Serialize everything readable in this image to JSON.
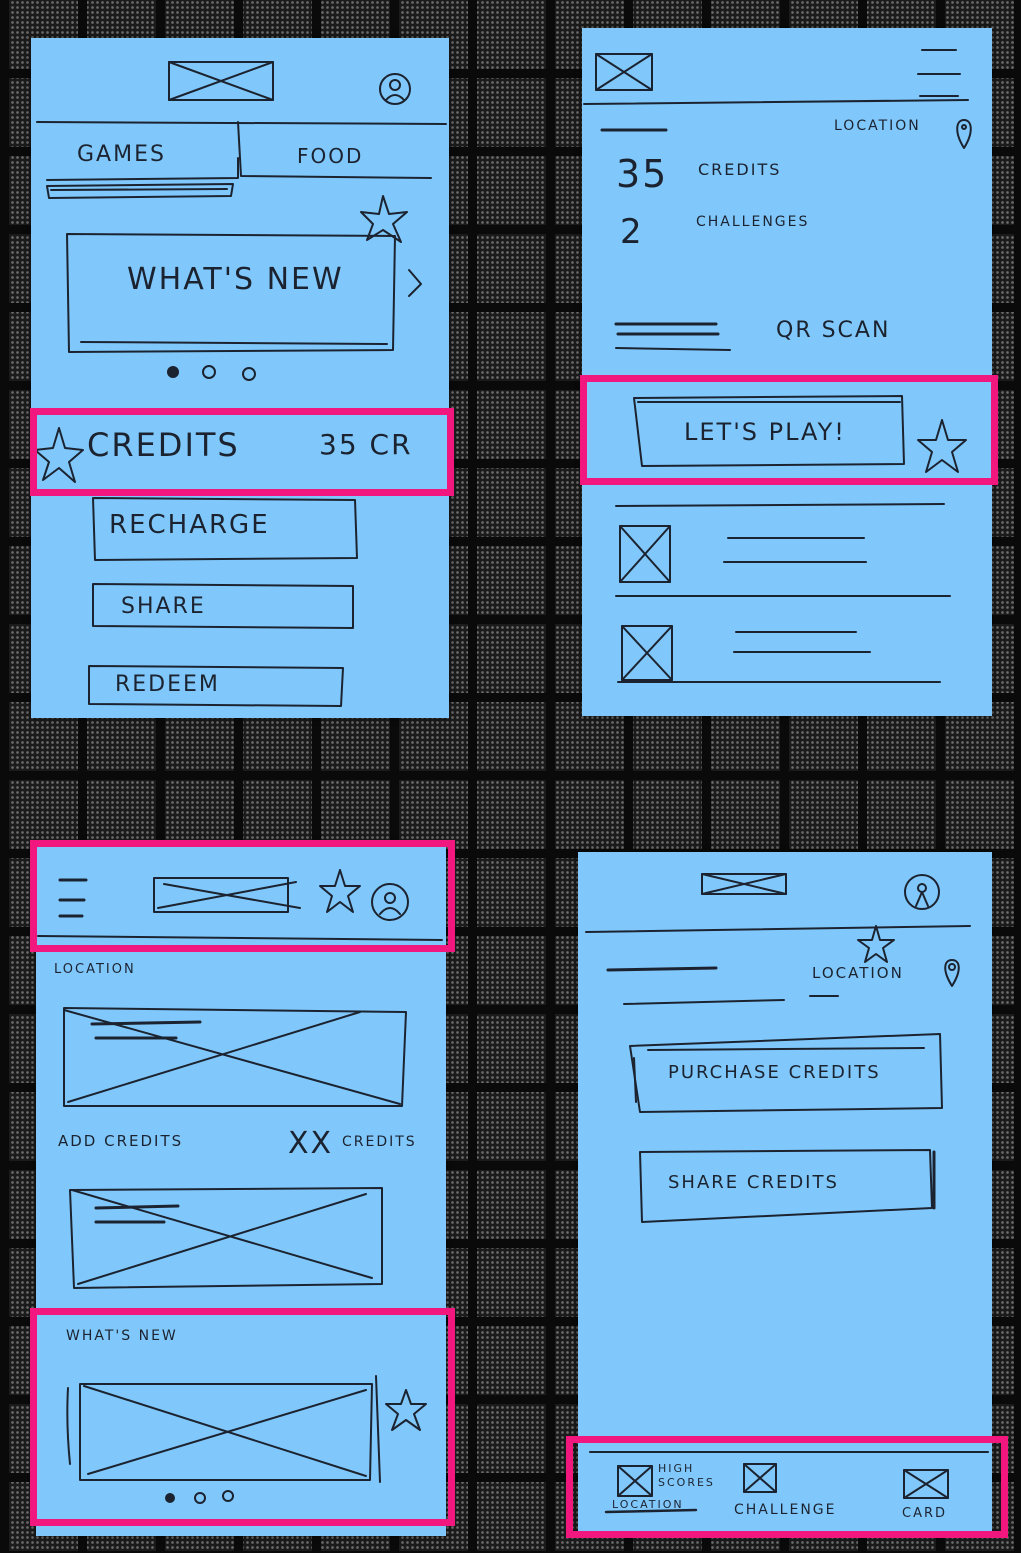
{
  "screen1": {
    "tab_games": "GAMES",
    "tab_food": "FOOD",
    "carousel_text": "WHAT'S NEW",
    "credits_label": "CREDITS",
    "credits_value": "35 CR",
    "recharge_label": "RECHARGE",
    "share_label": "SHARE",
    "redeem_label": "REDEEM"
  },
  "screen2": {
    "location_label": "LOCATION",
    "credits_count": "35",
    "credits_word": "CREDITS",
    "challenges_count": "2",
    "challenges_word": "CHALLENGES",
    "qr_scan_label": "QR SCAN",
    "lets_play_label": "LET'S PLAY!"
  },
  "screen3": {
    "location_label": "LOCATION",
    "add_credits_label": "ADD CREDITS",
    "credits_amount": "XX",
    "credits_word": "CREDITS",
    "whats_new_label": "WHAT'S NEW"
  },
  "screen4": {
    "location_label": "LOCATION",
    "purchase_credits_label": "PURCHASE CREDITS",
    "share_credits_label": "SHARE CREDITS",
    "nav_high_scores": "HIGH SCORES",
    "nav_location_struck": "LOCATION",
    "nav_challenge": "CHALLENGE",
    "nav_card": "CARD"
  },
  "colors": {
    "sticky_note": "#80c8fb",
    "highlight": "#f2167f",
    "ink": "#1c2330"
  },
  "icons": [
    "logo-placeholder-icon",
    "profile-icon",
    "menu-icon",
    "star-icon",
    "location-pin-icon",
    "chevron-right-icon",
    "image-placeholder-icon"
  ]
}
